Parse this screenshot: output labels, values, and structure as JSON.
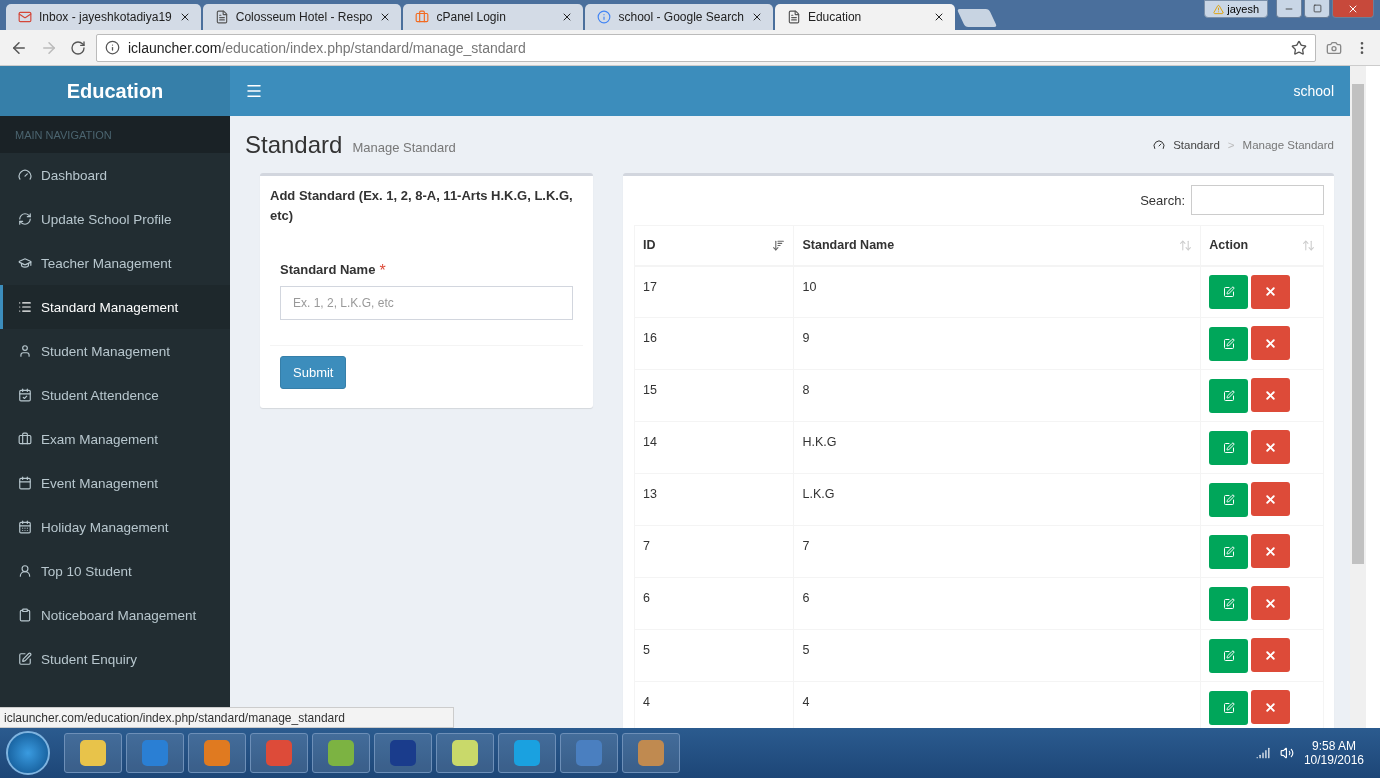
{
  "browser": {
    "tabs": [
      {
        "title": "Inbox - jayeshkotadiya19",
        "selected": false
      },
      {
        "title": "Colosseum Hotel - Respo",
        "selected": false
      },
      {
        "title": "cPanel Login",
        "selected": false
      },
      {
        "title": "school - Google Search",
        "selected": false
      },
      {
        "title": "Education",
        "selected": true
      }
    ],
    "user": "jayesh",
    "url_host": "iclauncher.com",
    "url_path": "/education/index.php/standard/manage_standard"
  },
  "app": {
    "brand": "Education",
    "top_right": "school",
    "sidebar": {
      "heading": "MAIN NAVIGATION",
      "items": [
        {
          "label": "Dashboard",
          "selected": false
        },
        {
          "label": "Update School Profile",
          "selected": false
        },
        {
          "label": "Teacher Management",
          "selected": false
        },
        {
          "label": "Standard Management",
          "selected": true
        },
        {
          "label": "Student Management",
          "selected": false
        },
        {
          "label": "Student Attendence",
          "selected": false
        },
        {
          "label": "Exam Management",
          "selected": false
        },
        {
          "label": "Event Management",
          "selected": false
        },
        {
          "label": "Holiday Management",
          "selected": false
        },
        {
          "label": "Top 10 Student",
          "selected": false
        },
        {
          "label": "Noticeboard Management",
          "selected": false
        },
        {
          "label": "Student Enquiry",
          "selected": false
        }
      ]
    },
    "page_title": "Standard",
    "page_subtitle": "Manage Standard",
    "breadcrumb": {
      "items": [
        "Standard",
        "Manage Standard"
      ],
      "separator": ">"
    },
    "form": {
      "title": "Add Standard (Ex. 1, 2, 8-A, 11-Arts H.K.G, L.K.G, etc)",
      "field_label": "Standard Name",
      "required_mark": "*",
      "placeholder": "Ex. 1, 2, L.K.G, etc",
      "submit": "Submit"
    },
    "table": {
      "search_label": "Search:",
      "columns": [
        {
          "label": "ID",
          "sorted": true
        },
        {
          "label": "Standard Name",
          "sorted": false
        },
        {
          "label": "Action",
          "sorted": false
        }
      ],
      "rows": [
        {
          "id": "17",
          "name": "10"
        },
        {
          "id": "16",
          "name": "9"
        },
        {
          "id": "15",
          "name": "8"
        },
        {
          "id": "14",
          "name": "H.K.G"
        },
        {
          "id": "13",
          "name": "L.K.G"
        },
        {
          "id": "7",
          "name": "7"
        },
        {
          "id": "6",
          "name": "6"
        },
        {
          "id": "5",
          "name": "5"
        },
        {
          "id": "4",
          "name": "4"
        }
      ]
    }
  },
  "status_url": "iclauncher.com/education/index.php/standard/manage_standard",
  "taskbar": {
    "time": "9:58 AM",
    "date": "10/19/2016"
  }
}
